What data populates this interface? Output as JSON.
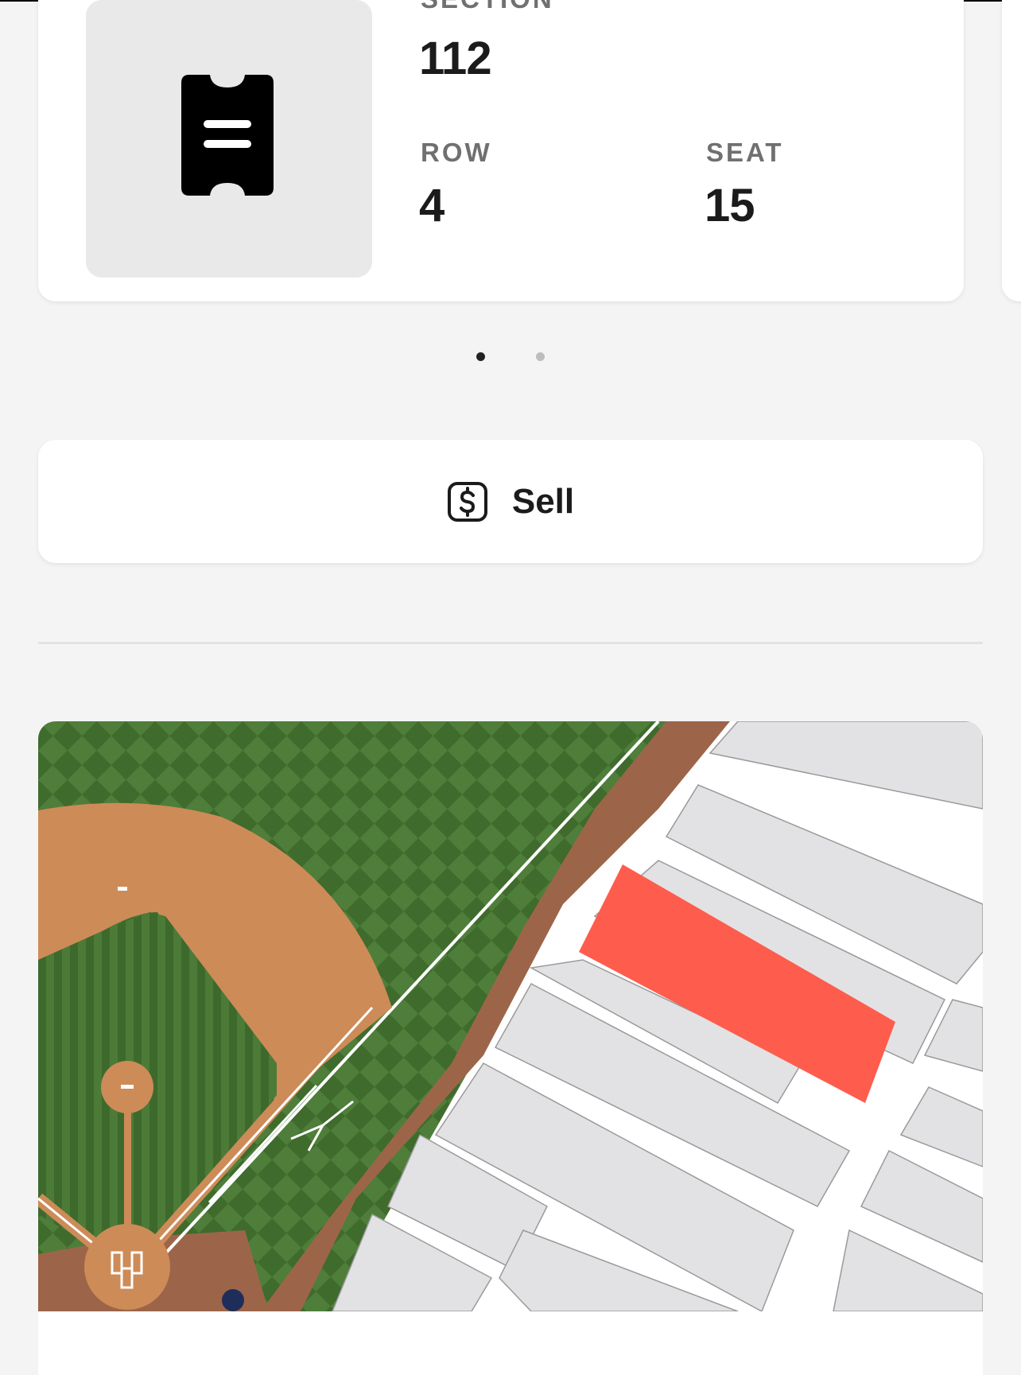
{
  "ticket": {
    "section_label": "SECTION",
    "section_value": "112",
    "row_label": "ROW",
    "row_value": "4",
    "seat_label": "SEAT",
    "seat_value": "15"
  },
  "pager": {
    "current_page": 1,
    "total_pages": 2
  },
  "actions": {
    "sell_label": "Sell",
    "sell_icon": "dollar-square-icon"
  },
  "icons": {
    "ticket": "ticket-icon"
  },
  "map": {
    "highlighted_section_color": "#fe5c4c",
    "grass_color": "#4a7a36",
    "dirt_color": "#cd8b58",
    "warning_track_color": "#9c6549",
    "seating_color": "#e2e2e4"
  }
}
